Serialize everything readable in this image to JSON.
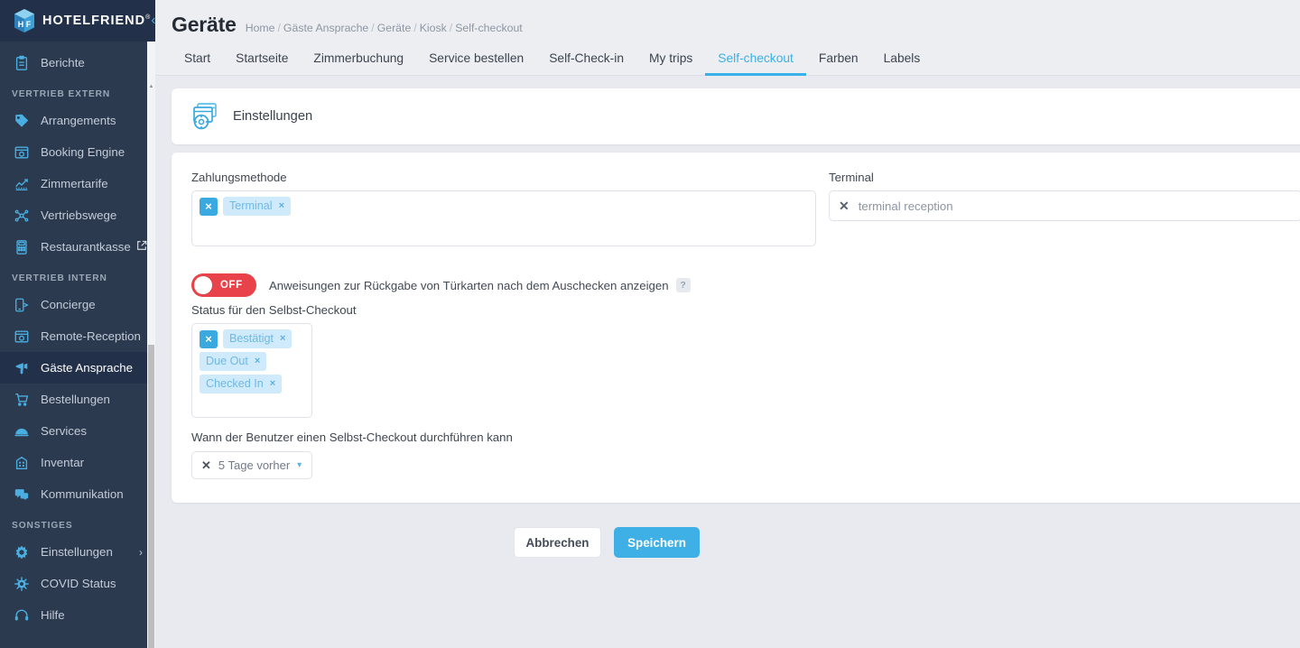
{
  "brand": {
    "name": "HOTELFRIEND",
    "registered": "®",
    "collapse_icon": "chevron-double-left"
  },
  "sidebar": {
    "items": [
      {
        "label": "Berichte",
        "icon": "clipboard-icon",
        "type": "item",
        "active": false
      },
      {
        "label": "VERTRIEB EXTERN",
        "type": "section"
      },
      {
        "label": "Arrangements",
        "icon": "tag-icon",
        "type": "item",
        "active": false
      },
      {
        "label": "Booking Engine",
        "icon": "browser-gear-icon",
        "type": "item",
        "active": false
      },
      {
        "label": "Zimmertarife",
        "icon": "chart-up-icon",
        "type": "item",
        "active": false
      },
      {
        "label": "Vertriebswege",
        "icon": "network-icon",
        "type": "item",
        "active": false
      },
      {
        "label": "Restaurantkasse",
        "icon": "pos-terminal-icon",
        "type": "item",
        "active": false,
        "external": true
      },
      {
        "label": "VERTRIEB INTERN",
        "type": "section"
      },
      {
        "label": "Concierge",
        "icon": "mobile-arrow-icon",
        "type": "item",
        "active": false
      },
      {
        "label": "Remote-Reception",
        "icon": "browser-gear-icon",
        "type": "item",
        "active": false
      },
      {
        "label": "Gäste Ansprache",
        "icon": "megaphone-icon",
        "type": "item",
        "active": true
      },
      {
        "label": "Bestellungen",
        "icon": "cart-icon",
        "type": "item",
        "active": false
      },
      {
        "label": "Services",
        "icon": "bell-dome-icon",
        "type": "item",
        "active": false
      },
      {
        "label": "Inventar",
        "icon": "building-icon",
        "type": "item",
        "active": false
      },
      {
        "label": "Kommunikation",
        "icon": "chat-icon",
        "type": "item",
        "active": false
      },
      {
        "label": "SONSTIGES",
        "type": "section"
      },
      {
        "label": "Einstellungen",
        "icon": "gear-icon",
        "type": "item",
        "active": false,
        "chevron": "›"
      },
      {
        "label": "COVID Status",
        "icon": "virus-icon",
        "type": "item",
        "active": false
      },
      {
        "label": "Hilfe",
        "icon": "headset-icon",
        "type": "item",
        "active": false
      }
    ]
  },
  "header": {
    "title": "Geräte",
    "breadcrumb": [
      "Home",
      "Gäste Ansprache",
      "Geräte",
      "Kiosk",
      "Self-checkout"
    ],
    "separator": "/"
  },
  "tabs": [
    {
      "label": "Start",
      "active": false
    },
    {
      "label": "Startseite",
      "active": false
    },
    {
      "label": "Zimmerbuchung",
      "active": false
    },
    {
      "label": "Service bestellen",
      "active": false
    },
    {
      "label": "Self-Check-in",
      "active": false
    },
    {
      "label": "My trips",
      "active": false
    },
    {
      "label": "Self-checkout",
      "active": true
    },
    {
      "label": "Farben",
      "active": false
    },
    {
      "label": "Labels",
      "active": false
    }
  ],
  "settings_card": {
    "icon": "settings-windows-icon",
    "title": "Einstellungen"
  },
  "form": {
    "payment_method": {
      "label": "Zahlungsmethode",
      "clear_icon": "×",
      "chips": [
        {
          "label": "Terminal",
          "remove": "×"
        }
      ]
    },
    "terminal": {
      "label": "Terminal",
      "clear_icon": "✕",
      "value": "terminal reception"
    },
    "door_card_toggle": {
      "state": "OFF",
      "label": "Anweisungen zur Rückgabe von Türkarten nach dem Auschecken anzeigen",
      "help_icon": "?"
    },
    "status": {
      "label": "Status für den Selbst-Checkout",
      "clear_icon": "×",
      "chips": [
        {
          "label": "Bestätigt",
          "remove": "×"
        },
        {
          "label": "Due Out",
          "remove": "×"
        },
        {
          "label": "Checked In",
          "remove": "×"
        }
      ]
    },
    "when": {
      "label": "Wann der Benutzer einen Selbst-Checkout durchführen kann",
      "clear_icon": "✕",
      "value": "5 Tage vorher",
      "chevron_icon": "⌄"
    }
  },
  "actions": {
    "cancel_label": "Abbrechen",
    "save_label": "Speichern"
  },
  "colors": {
    "accent": "#3fb0e5",
    "sidebar_bg": "#2b3a4f",
    "toggle_off": "#e8434a",
    "chip_bg": "#cfeafb",
    "page_bg": "#e8eaef"
  }
}
